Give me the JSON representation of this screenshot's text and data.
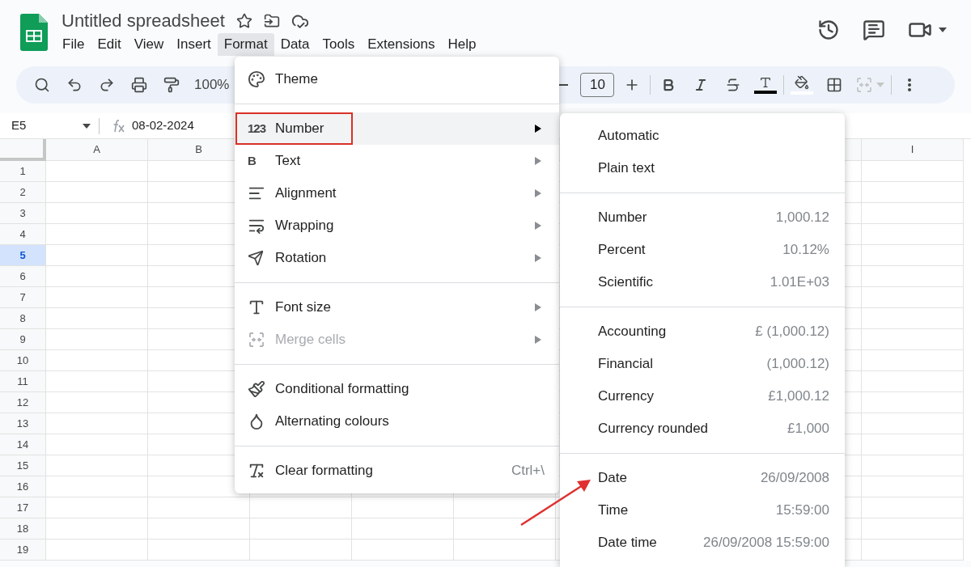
{
  "document": {
    "title": "Untitled spreadsheet"
  },
  "menu_bar": [
    {
      "label": "File",
      "selected": false
    },
    {
      "label": "Edit",
      "selected": false
    },
    {
      "label": "View",
      "selected": false
    },
    {
      "label": "Insert",
      "selected": false
    },
    {
      "label": "Format",
      "selected": true
    },
    {
      "label": "Data",
      "selected": false
    },
    {
      "label": "Tools",
      "selected": false
    },
    {
      "label": "Extensions",
      "selected": false
    },
    {
      "label": "Help",
      "selected": false
    }
  ],
  "toolbar": {
    "zoom": "100%",
    "font_size": "10"
  },
  "formula_bar": {
    "cell_ref": "E5",
    "value": "08-02-2024"
  },
  "sheet": {
    "column_headers": [
      {
        "label": "A"
      },
      {
        "label": "B"
      },
      {
        "label": "I"
      }
    ],
    "rows": [
      {
        "label": "1",
        "selected": false
      },
      {
        "label": "2",
        "selected": false
      },
      {
        "label": "3",
        "selected": false
      },
      {
        "label": "4",
        "selected": false
      },
      {
        "label": "5",
        "selected": true
      },
      {
        "label": "6",
        "selected": false
      },
      {
        "label": "7",
        "selected": false
      },
      {
        "label": "8",
        "selected": false
      },
      {
        "label": "9",
        "selected": false
      },
      {
        "label": "10",
        "selected": false
      },
      {
        "label": "11",
        "selected": false
      },
      {
        "label": "12",
        "selected": false
      },
      {
        "label": "13",
        "selected": false
      },
      {
        "label": "14",
        "selected": false
      },
      {
        "label": "15",
        "selected": false
      },
      {
        "label": "16",
        "selected": false
      },
      {
        "label": "17",
        "selected": false
      },
      {
        "label": "18",
        "selected": false
      },
      {
        "label": "19",
        "selected": false
      }
    ]
  },
  "format_menu": [
    {
      "kind": "item",
      "label": "Theme",
      "selected": false,
      "disabled": false,
      "submenu": false
    },
    {
      "kind": "separator"
    },
    {
      "kind": "item",
      "icon_text": "123",
      "label": "Number",
      "selected": true,
      "disabled": false,
      "submenu": true,
      "outlined": true
    },
    {
      "kind": "item",
      "icon_text": "B",
      "label": "Text",
      "selected": false,
      "disabled": false,
      "submenu": true
    },
    {
      "kind": "item",
      "label": "Alignment",
      "selected": false,
      "disabled": false,
      "submenu": true
    },
    {
      "kind": "item",
      "label": "Wrapping",
      "selected": false,
      "disabled": false,
      "submenu": true
    },
    {
      "kind": "item",
      "label": "Rotation",
      "selected": false,
      "disabled": false,
      "submenu": true
    },
    {
      "kind": "separator"
    },
    {
      "kind": "item",
      "label": "Font size",
      "selected": false,
      "disabled": false,
      "submenu": true
    },
    {
      "kind": "item",
      "label": "Merge cells",
      "selected": false,
      "disabled": true,
      "submenu": true
    },
    {
      "kind": "separator"
    },
    {
      "kind": "item",
      "label": "Conditional formatting",
      "selected": false,
      "disabled": false,
      "submenu": false
    },
    {
      "kind": "item",
      "label": "Alternating colours",
      "selected": false,
      "disabled": false,
      "submenu": false
    },
    {
      "kind": "separator"
    },
    {
      "kind": "item",
      "label": "Clear formatting",
      "shortcut": "Ctrl+\\",
      "selected": false,
      "disabled": false,
      "submenu": false
    }
  ],
  "number_submenu": [
    {
      "kind": "item",
      "label": "Automatic"
    },
    {
      "kind": "item",
      "label": "Plain text"
    },
    {
      "kind": "separator"
    },
    {
      "kind": "item",
      "label": "Number",
      "example": "1,000.12"
    },
    {
      "kind": "item",
      "label": "Percent",
      "example": "10.12%"
    },
    {
      "kind": "item",
      "label": "Scientific",
      "example": "1.01E+03"
    },
    {
      "kind": "separator"
    },
    {
      "kind": "item",
      "label": "Accounting",
      "example": "£ (1,000.12)"
    },
    {
      "kind": "item",
      "label": "Financial",
      "example": "(1,000.12)"
    },
    {
      "kind": "item",
      "label": "Currency",
      "example": "£1,000.12"
    },
    {
      "kind": "item",
      "label": "Currency rounded",
      "example": "£1,000"
    },
    {
      "kind": "separator"
    },
    {
      "kind": "item",
      "label": "Date",
      "example": "26/09/2008"
    },
    {
      "kind": "item",
      "label": "Time",
      "example": "15:59:00"
    },
    {
      "kind": "item",
      "label": "Date time",
      "example": "26/09/2008 15:59:00"
    }
  ],
  "annotation": {
    "kind": "arrow",
    "color": "#e03030"
  }
}
